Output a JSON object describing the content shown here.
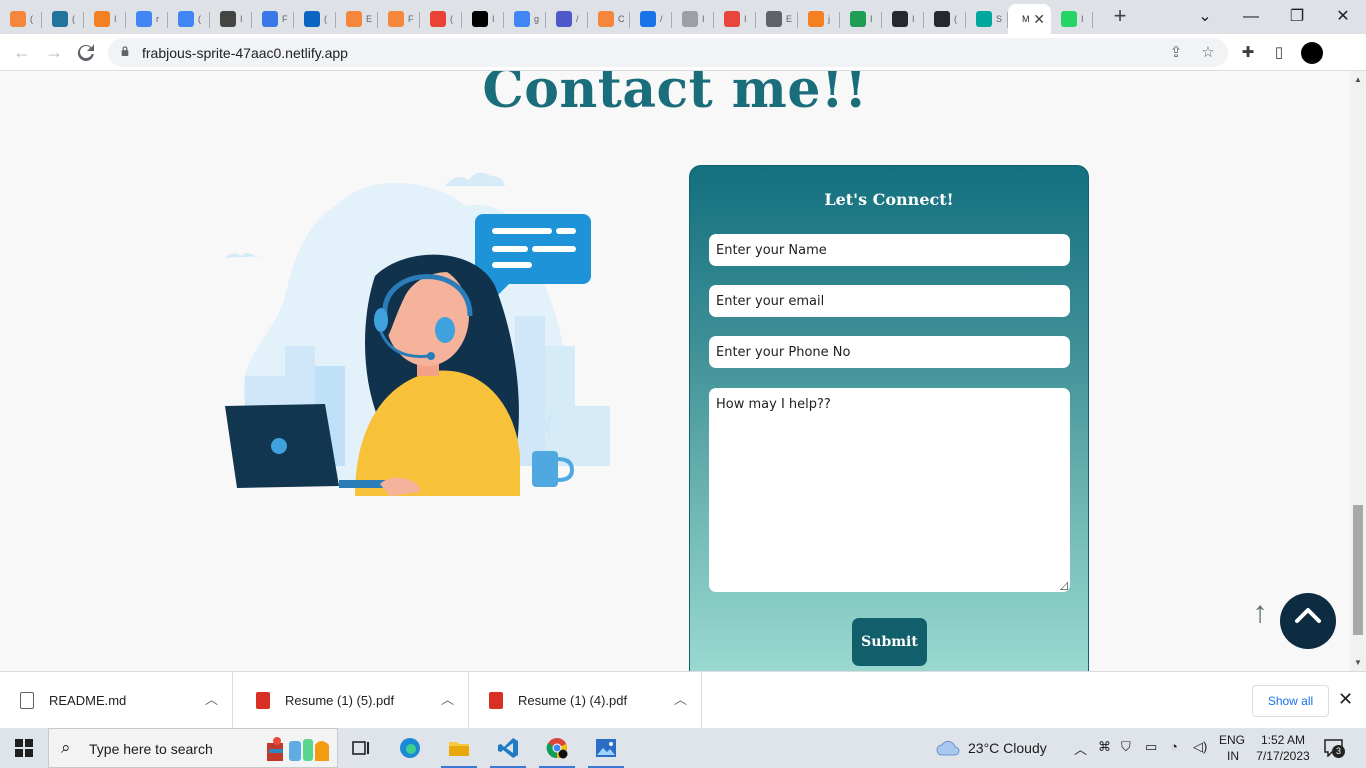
{
  "browser": {
    "tabs": [
      {
        "label": "(",
        "color": "#f5873c"
      },
      {
        "label": "(",
        "color": "#21759b"
      },
      {
        "label": "I",
        "color": "#f48024"
      },
      {
        "label": "r",
        "color": "#4285f4"
      },
      {
        "label": "(",
        "color": "#4285f4"
      },
      {
        "label": "I",
        "color": "#444444"
      },
      {
        "label": "F",
        "color": "#3b78e7"
      },
      {
        "label": "(",
        "color": "#0a66c2"
      },
      {
        "label": "E",
        "color": "#f5873c"
      },
      {
        "label": "F",
        "color": "#f5873c"
      },
      {
        "label": "(",
        "color": "#ea4335"
      },
      {
        "label": "I",
        "color": "#000000"
      },
      {
        "label": "g",
        "color": "#4285f4"
      },
      {
        "label": "/",
        "color": "#5059c9"
      },
      {
        "label": "C",
        "color": "#f5873c"
      },
      {
        "label": "/",
        "color": "#1a73e8"
      },
      {
        "label": "I",
        "color": "#9aa0a6"
      },
      {
        "label": "I",
        "color": "#e8453c"
      },
      {
        "label": "E",
        "color": "#5f6368"
      },
      {
        "label": "j",
        "color": "#f48024"
      },
      {
        "label": "I",
        "color": "#1f9d55"
      },
      {
        "label": "I",
        "color": "#24292e"
      },
      {
        "label": "(",
        "color": "#24292e"
      },
      {
        "label": "S",
        "color": "#00a79d"
      },
      {
        "label": "M",
        "color": "#ffffff",
        "active": true
      },
      {
        "label": "I",
        "color": "#25d366"
      }
    ],
    "url": "frabjous-sprite-47aac0.netlify.app"
  },
  "page": {
    "title": "Contact me!!",
    "form": {
      "heading": "Let's Connect!",
      "name_placeholder": "Enter your Name",
      "email_placeholder": "Enter your email",
      "phone_placeholder": "Enter your Phone No",
      "message_placeholder": "How may I help??",
      "submit_label": "Submit"
    },
    "scroll_up_arrow": "↑"
  },
  "downloads": {
    "items": [
      {
        "name": "README.md",
        "icon": "file-icon",
        "color": "#5f6368"
      },
      {
        "name": "Resume (1) (5).pdf",
        "icon": "pdf-icon",
        "color": "#d93025"
      },
      {
        "name": "Resume (1) (4).pdf",
        "icon": "pdf-icon",
        "color": "#d93025"
      }
    ],
    "show_all": "Show all"
  },
  "taskbar": {
    "search_placeholder": "Type here to search",
    "weather": "23°C  Cloudy",
    "lang_top": "ENG",
    "lang_bottom": "IN",
    "time": "1:52 AM",
    "date": "7/17/2023",
    "notifications": "3"
  }
}
